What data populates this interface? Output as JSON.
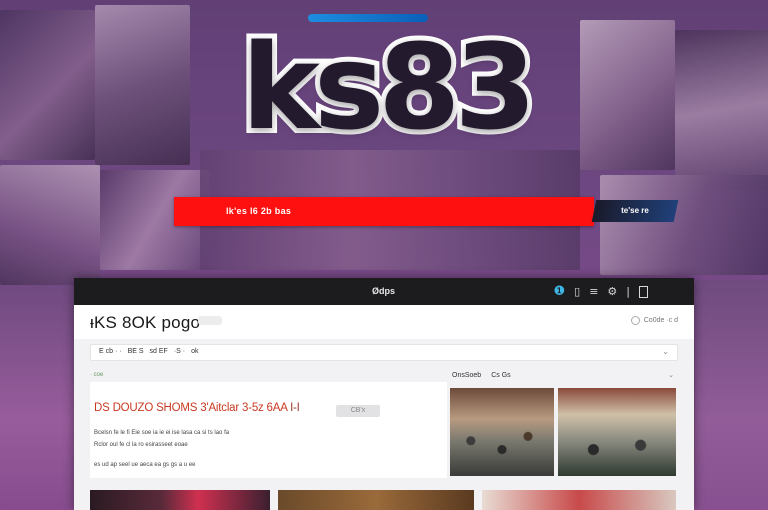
{
  "logo": {
    "text": "ks83"
  },
  "banner": {
    "text": "lk'es l6 2b bas",
    "tag": "te'se  re"
  },
  "browser": {
    "site_label": "Ødps",
    "toolbar_icons": [
      "app-icon",
      "filter-icon",
      "menu-icon",
      "settings-icon",
      "more-icon",
      "window-icon"
    ],
    "brand": "ᵻKS 8OK pogo",
    "header_right": "Co0de  ·c  d",
    "nav_items": [
      "E cb · ·",
      "BE S",
      "sd EF",
      "·S ·",
      "ok"
    ],
    "section_label": "· coe",
    "section_right": [
      "OnsSoeb",
      "Cs Gs"
    ],
    "headline": "DS DOUZO SHOMS 3'Aitclar 3-5z 6AA",
    "headline_tail": "I-I",
    "pill": "CB'x",
    "article_lines": [
      "Bcelsn fe le fi Eie soe ia ie ei ise lasa ca si ts lao fa",
      "Rclor oul fe cl la ro esirasseet eoae",
      "es ud ap seel ue aeca ea gs gs a u ee"
    ]
  }
}
